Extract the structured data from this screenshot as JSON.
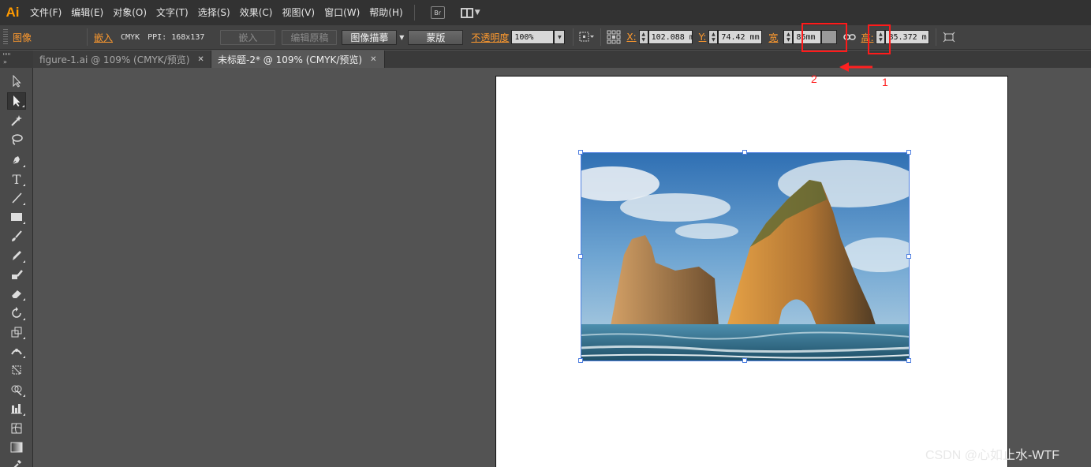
{
  "app": {
    "logo": "Ai"
  },
  "menu": [
    "文件(F)",
    "编辑(E)",
    "对象(O)",
    "文字(T)",
    "选择(S)",
    "效果(C)",
    "视图(V)",
    "窗口(W)",
    "帮助(H)"
  ],
  "menubar_right": {
    "bridge_label": "Br"
  },
  "control": {
    "title": "图像",
    "embed_link": "嵌入",
    "color_mode": "CMYK",
    "ppi": "PPI: 168x137",
    "embed_button": "嵌入",
    "edit_original": "编辑原稿",
    "image_trace": "图像描摹",
    "mask": "蒙版",
    "opacity_label": "不透明度",
    "opacity_value": "100%",
    "x_label": "X:",
    "x_value": "102.088 m",
    "y_label": "Y:",
    "y_value": "74.42 mm",
    "width_label": "宽",
    "width_value": "85mm",
    "height_label": "高:",
    "height_value": "85.372 m"
  },
  "tabs": [
    {
      "label": "figure-1.ai @ 109% (CMYK/预览)",
      "active": false
    },
    {
      "label": "未标题-2* @ 109% (CMYK/预览)",
      "active": true
    }
  ],
  "tools": [
    "selection-tool",
    "direct-selection-tool",
    "magic-wand-tool",
    "lasso-tool",
    "pen-tool",
    "type-tool",
    "line-segment-tool",
    "rectangle-tool",
    "paintbrush-tool",
    "pencil-tool",
    "blob-brush-tool",
    "eraser-tool",
    "rotate-tool",
    "scale-tool",
    "width-tool",
    "free-transform-tool",
    "shape-builder-tool",
    "column-graph-tool",
    "mesh-tool",
    "gradient-tool",
    "eyedropper-tool"
  ],
  "annotations": {
    "label_1": "1",
    "label_2": "2",
    "accent": "#ff1a1a"
  },
  "watermark": "CSDN @心如止水-WTF"
}
